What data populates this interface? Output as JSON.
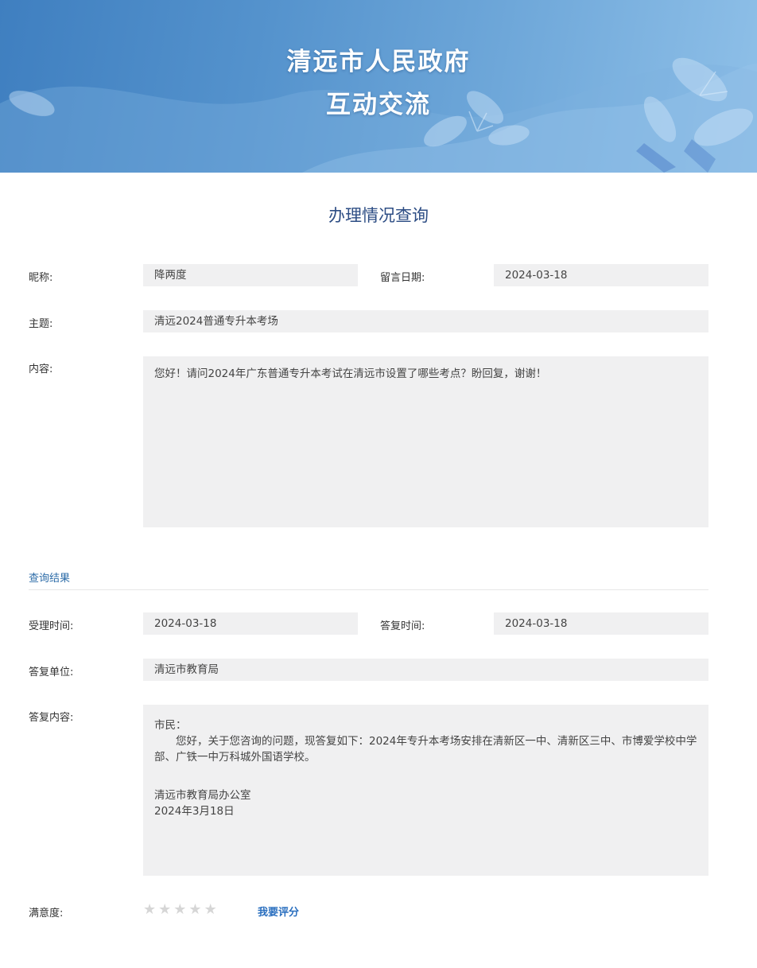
{
  "banner": {
    "title_line1": "清远市人民政府",
    "title_line2": "互动交流"
  },
  "page_title": "办理情况查询",
  "message": {
    "nickname_label": "昵称:",
    "nickname": "降两度",
    "date_label": "留言日期:",
    "date": "2024-03-18",
    "subject_label": "主题:",
    "subject": "清远2024普通专升本考场",
    "content_label": "内容:",
    "content": "您好！请问2024年广东普通专升本考试在清远市设置了哪些考点？盼回复，谢谢！"
  },
  "result": {
    "heading": "查询结果",
    "accept_time_label": "受理时间:",
    "accept_time": "2024-03-18",
    "reply_time_label": "答复时间:",
    "reply_time": "2024-03-18",
    "reply_unit_label": "答复单位:",
    "reply_unit": "清远市教育局",
    "reply_content_label": "答复内容:",
    "reply_lines": [
      "市民：",
      "　　您好，关于您咨询的问题，现答复如下：2024年专升本考场安排在清新区一中、清新区三中、市博爱学校中学部、广铁一中万科城外国语学校。",
      "",
      "",
      "清远市教育局办公室",
      "2024年3月18日"
    ]
  },
  "satisfaction": {
    "label": "满意度:",
    "stars_total": 5,
    "stars_filled": 0,
    "rate_link": "我要评分"
  },
  "colors": {
    "banner": "#4f8cc9",
    "field_bg": "#f0f0f1",
    "accent": "#2a6fbf"
  }
}
